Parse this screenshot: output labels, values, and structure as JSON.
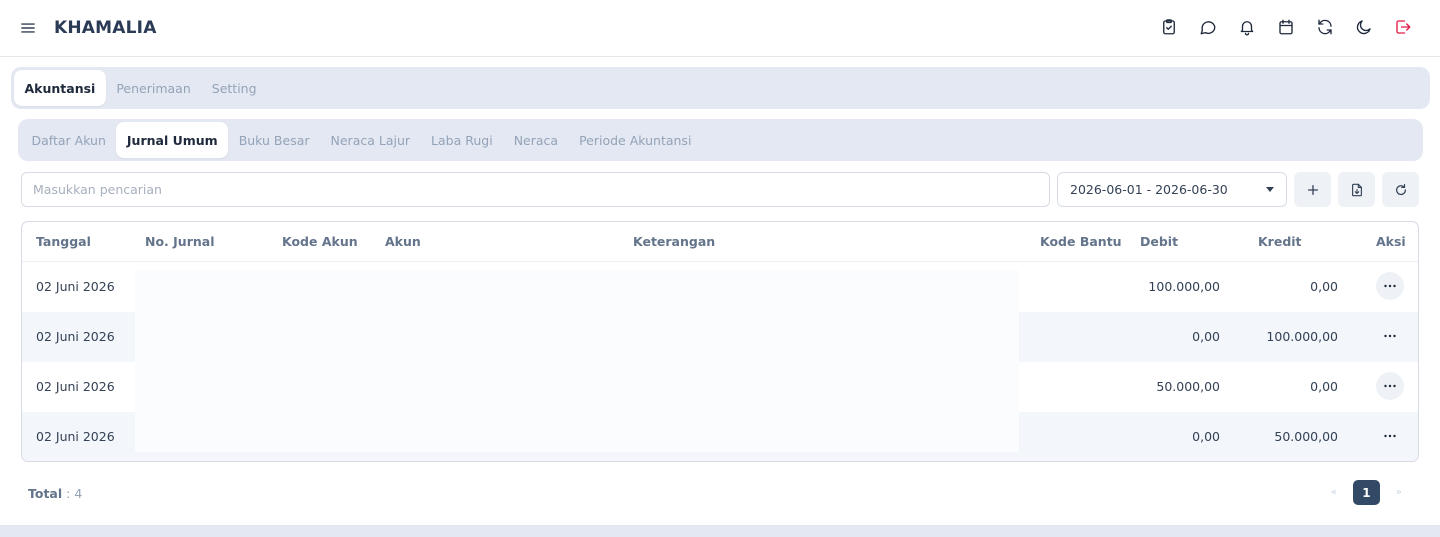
{
  "app": {
    "title": "KHAMALIA"
  },
  "top_icons": [
    "clipboard-check-icon",
    "chat-icon",
    "bell-icon",
    "calendar-icon",
    "refresh-icon",
    "moon-icon",
    "logout-icon"
  ],
  "main_tabs": [
    {
      "label": "Akuntansi",
      "active": true
    },
    {
      "label": "Penerimaan",
      "active": false
    },
    {
      "label": "Setting",
      "active": false
    }
  ],
  "sub_tabs": [
    {
      "label": "Daftar Akun",
      "active": false
    },
    {
      "label": "Jurnal Umum",
      "active": true
    },
    {
      "label": "Buku Besar",
      "active": false
    },
    {
      "label": "Neraca Lajur",
      "active": false
    },
    {
      "label": "Laba Rugi",
      "active": false
    },
    {
      "label": "Neraca",
      "active": false
    },
    {
      "label": "Periode Akuntansi",
      "active": false
    }
  ],
  "search": {
    "placeholder": "Masukkan pencarian",
    "value": ""
  },
  "date_range": {
    "value": "2026-06-01 - 2026-06-30"
  },
  "table": {
    "headers": {
      "tanggal": "Tanggal",
      "no_jurnal": "No. Jurnal",
      "kode_akun": "Kode Akun",
      "akun": "Akun",
      "keterangan": "Keterangan",
      "kode_bantu": "Kode Bantu",
      "debit": "Debit",
      "kredit": "Kredit",
      "aksi": "Aksi"
    },
    "rows": [
      {
        "tanggal": "02 Juni 2026",
        "debit": "100.000,00",
        "kredit": "0,00"
      },
      {
        "tanggal": "02 Juni 2026",
        "debit": "0,00",
        "kredit": "100.000,00"
      },
      {
        "tanggal": "02 Juni 2026",
        "debit": "50.000,00",
        "kredit": "0,00"
      },
      {
        "tanggal": "02 Juni 2026",
        "debit": "0,00",
        "kredit": "50.000,00"
      }
    ]
  },
  "footer": {
    "total_label": "Total",
    "total_value": ": 4",
    "current_page": "1",
    "prev": "«",
    "next": "»"
  },
  "colors": {
    "brand_text": "#2b3a55",
    "tab_bar_bg": "#e3e8f2",
    "pager_active": "#334a66",
    "logout_icon": "#e11d48"
  }
}
